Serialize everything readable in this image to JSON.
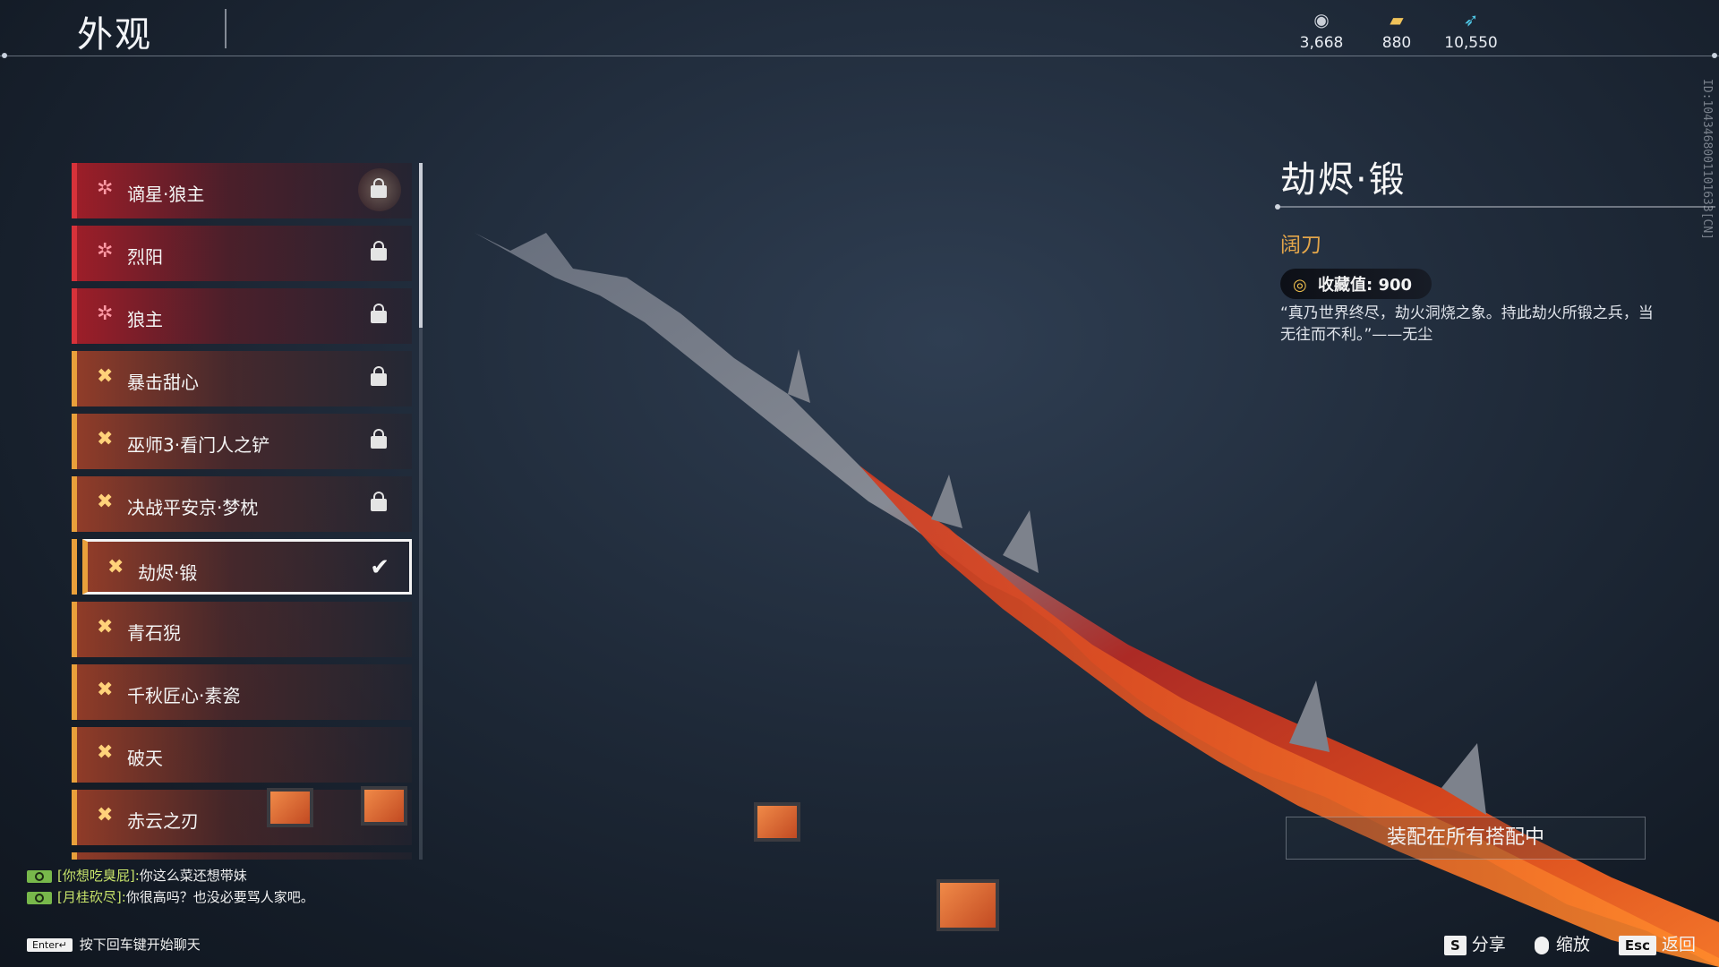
{
  "header": {
    "title": "外观",
    "currencies": [
      {
        "icon": "silver-coin-icon",
        "value": "3,668"
      },
      {
        "icon": "gold-ingot-icon",
        "value": "880"
      },
      {
        "icon": "blue-feather-icon",
        "value": "10,550"
      }
    ]
  },
  "list": {
    "items": [
      {
        "label": "谪星·狼主",
        "rarity": "red",
        "state": "locked"
      },
      {
        "label": "烈阳",
        "rarity": "red",
        "state": "locked"
      },
      {
        "label": "狼主",
        "rarity": "red",
        "state": "locked"
      },
      {
        "label": "暴击甜心",
        "rarity": "gold",
        "state": "locked"
      },
      {
        "label": "巫师3·看门人之铲",
        "rarity": "gold",
        "state": "locked"
      },
      {
        "label": "决战平安京·梦枕",
        "rarity": "gold",
        "state": "locked"
      },
      {
        "label": "劫烬·锻",
        "rarity": "gold",
        "state": "selected"
      },
      {
        "label": "青石猊",
        "rarity": "gold",
        "state": "owned"
      },
      {
        "label": "千秋匠心·素瓷",
        "rarity": "gold",
        "state": "owned"
      },
      {
        "label": "破天",
        "rarity": "gold",
        "state": "owned"
      },
      {
        "label": "赤云之刃",
        "rarity": "gold",
        "state": "locked"
      }
    ]
  },
  "detail": {
    "name": "劫烬·锻",
    "type": "阔刀",
    "collect_label": "收藏值: 900",
    "description": "“真乃世界终尽，劫火洞烧之象。持此劫火所锻之兵，当无往而不利。”——无尘"
  },
  "equip_all_label": "装配在所有搭配中",
  "vertical_id": "ID:1043468001101633[CN]",
  "chat": {
    "messages": [
      {
        "who": "[你想吃臭屁]:",
        "text": "你这么菜还想带妹"
      },
      {
        "who": "[月桂砍尽]:",
        "text": "你很高吗？也没必要骂人家吧。"
      }
    ],
    "hint_key": "Enter↵",
    "hint_text": "按下回车键开始聊天"
  },
  "footer": {
    "share_key": "S",
    "share_label": "分享",
    "zoom_label": "缩放",
    "back_key": "Esc",
    "back_label": "返回"
  },
  "colors": {
    "rarity_red": "#d7323a",
    "rarity_gold": "#e9a03b",
    "type_text": "#e2a54a"
  }
}
